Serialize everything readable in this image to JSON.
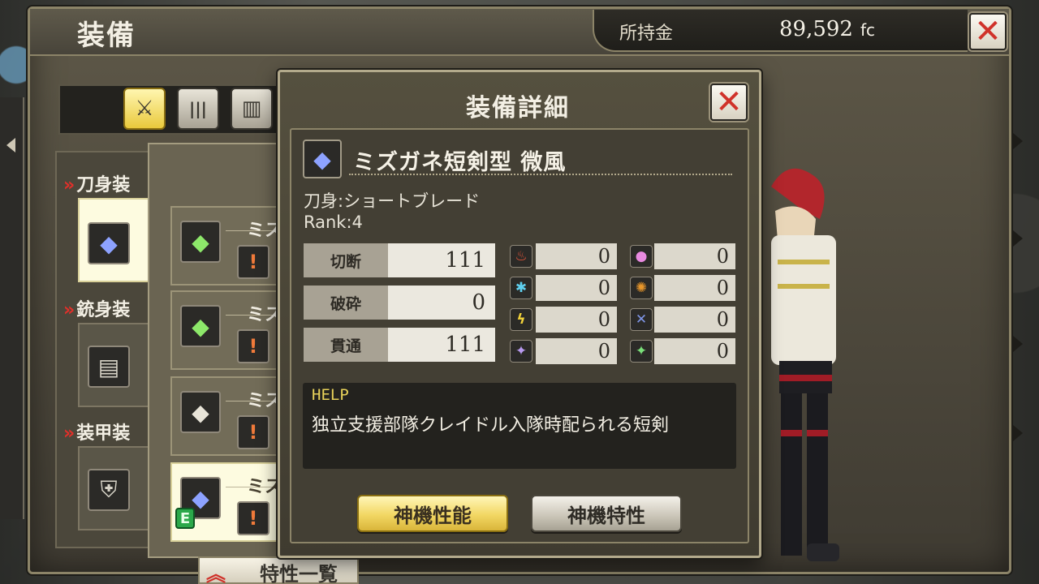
{
  "header": {
    "title": "装備",
    "money_label": "所持金",
    "money_value": "89,592",
    "money_unit": "fc",
    "close_glyph": "✕"
  },
  "tabs": [
    {
      "icon": "sword-icon",
      "glyph": "⚔",
      "active": true
    },
    {
      "icon": "bullets-icon",
      "glyph": "|||",
      "active": false
    },
    {
      "icon": "armor-plate-icon",
      "glyph": "▥",
      "active": false
    }
  ],
  "sidebar": {
    "sections": [
      {
        "label": "刀身装",
        "chevron": "»",
        "icon": "blade-icon"
      },
      {
        "label": "銃身装",
        "chevron": "»",
        "icon": "barrel-icon"
      },
      {
        "label": "装甲装",
        "chevron": "»",
        "icon": "armor-icon"
      }
    ]
  },
  "weapon_list": {
    "items": [
      {
        "name": "ミス",
        "icon": "green-blade-icon",
        "sub": "!",
        "equipped": false
      },
      {
        "name": "ミス",
        "icon": "green-blade-icon",
        "sub": "!",
        "equipped": false
      },
      {
        "name": "ミス",
        "icon": "white-blade-icon",
        "sub": "!",
        "equipped": false
      },
      {
        "name": "ミス",
        "icon": "blue-blade-icon",
        "sub": "!",
        "equipped": true,
        "equip_mark": "E"
      }
    ]
  },
  "trait_list": {
    "chevron": "︽",
    "label": "特性一覧"
  },
  "dialog": {
    "title": "装備詳細",
    "close_glyph": "✕",
    "weapon_name": "ミズガネ短剣型 微風",
    "weapon_type": "刀身:ショートブレード",
    "rank": "Rank:4",
    "stats": [
      {
        "label": "切断",
        "value": "111"
      },
      {
        "label": "破砕",
        "value": "0"
      },
      {
        "label": "貫通",
        "value": "111"
      }
    ],
    "elements": [
      {
        "icon": "fire-icon",
        "glyph": "♨",
        "color": "#e5553a",
        "value": "0"
      },
      {
        "icon": "ice-icon",
        "glyph": "✱",
        "color": "#5fd0f0",
        "value": "0"
      },
      {
        "icon": "thunder-icon",
        "glyph": "ϟ",
        "color": "#f2d23a",
        "value": "0"
      },
      {
        "icon": "divine-icon",
        "glyph": "✦",
        "color": "#b89af0",
        "value": "0"
      },
      {
        "icon": "pink-orb-icon",
        "glyph": "●",
        "color": "#e88ae0",
        "value": "0"
      },
      {
        "icon": "burst-icon",
        "glyph": "✺",
        "color": "#e8962a",
        "value": "0"
      },
      {
        "icon": "crossed-blades-icon",
        "glyph": "✕",
        "color": "#7f96e8",
        "value": "0"
      },
      {
        "icon": "green-star-icon",
        "glyph": "✦",
        "color": "#7ae07a",
        "value": "0"
      }
    ],
    "help_title": "HELP",
    "help_text": "独立支援部隊クレイドル入隊時配られる短剣",
    "buttons": {
      "performance": "神機性能",
      "traits": "神機特性"
    }
  },
  "colors": {
    "accent_gold": "#f2d763",
    "close_red": "#d0322a",
    "panel": "#433f34"
  }
}
